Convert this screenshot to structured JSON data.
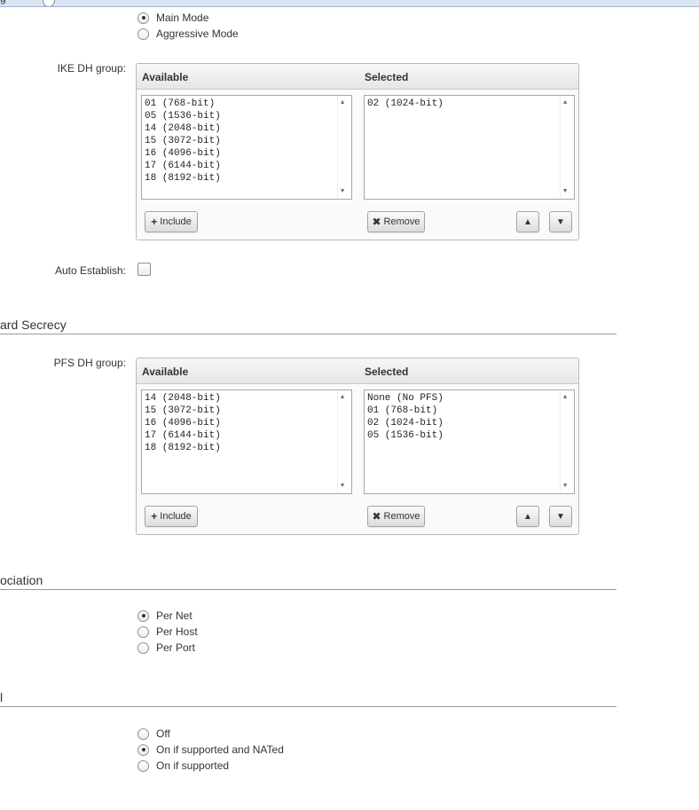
{
  "top_cut_label": "...",
  "ike_mode": {
    "options": [
      {
        "label": "Main Mode",
        "checked": true
      },
      {
        "label": "Aggressive Mode",
        "checked": false
      }
    ]
  },
  "ike_dh": {
    "label": "IKE DH group:",
    "available_header": "Available",
    "selected_header": "Selected",
    "available": [
      "01 (768-bit)",
      "05 (1536-bit)",
      "14 (2048-bit)",
      "15 (3072-bit)",
      "16 (4096-bit)",
      "17 (6144-bit)",
      "18 (8192-bit)"
    ],
    "selected": [
      "02 (1024-bit)"
    ],
    "include_label": "Include",
    "remove_label": "Remove",
    "include_icon": "plus-icon",
    "remove_icon": "x-icon",
    "up_icon": "chevron-up-icon",
    "down_icon": "chevron-down-icon"
  },
  "auto_establish": {
    "label": "Auto Establish:",
    "checked": false
  },
  "pfs_section_title": "ard Secrecy",
  "pfs_dh": {
    "label": "PFS DH group:",
    "available_header": "Available",
    "selected_header": "Selected",
    "available": [
      "14 (2048-bit)",
      "15 (3072-bit)",
      "16 (4096-bit)",
      "17 (6144-bit)",
      "18 (8192-bit)"
    ],
    "selected": [
      "None (No PFS)",
      "01 (768-bit)",
      "02 (1024-bit)",
      "05 (1536-bit)"
    ],
    "include_label": "Include",
    "remove_label": "Remove"
  },
  "association_section_title": "ociation",
  "association": {
    "options": [
      {
        "label": "Per Net",
        "checked": true
      },
      {
        "label": "Per Host",
        "checked": false
      },
      {
        "label": "Per Port",
        "checked": false
      }
    ]
  },
  "last_section_title": "l",
  "nat_mode": {
    "options": [
      {
        "label": "Off",
        "checked": false
      },
      {
        "label": "On if supported and NATed",
        "checked": true
      },
      {
        "label": "On if supported",
        "checked": false
      }
    ]
  }
}
